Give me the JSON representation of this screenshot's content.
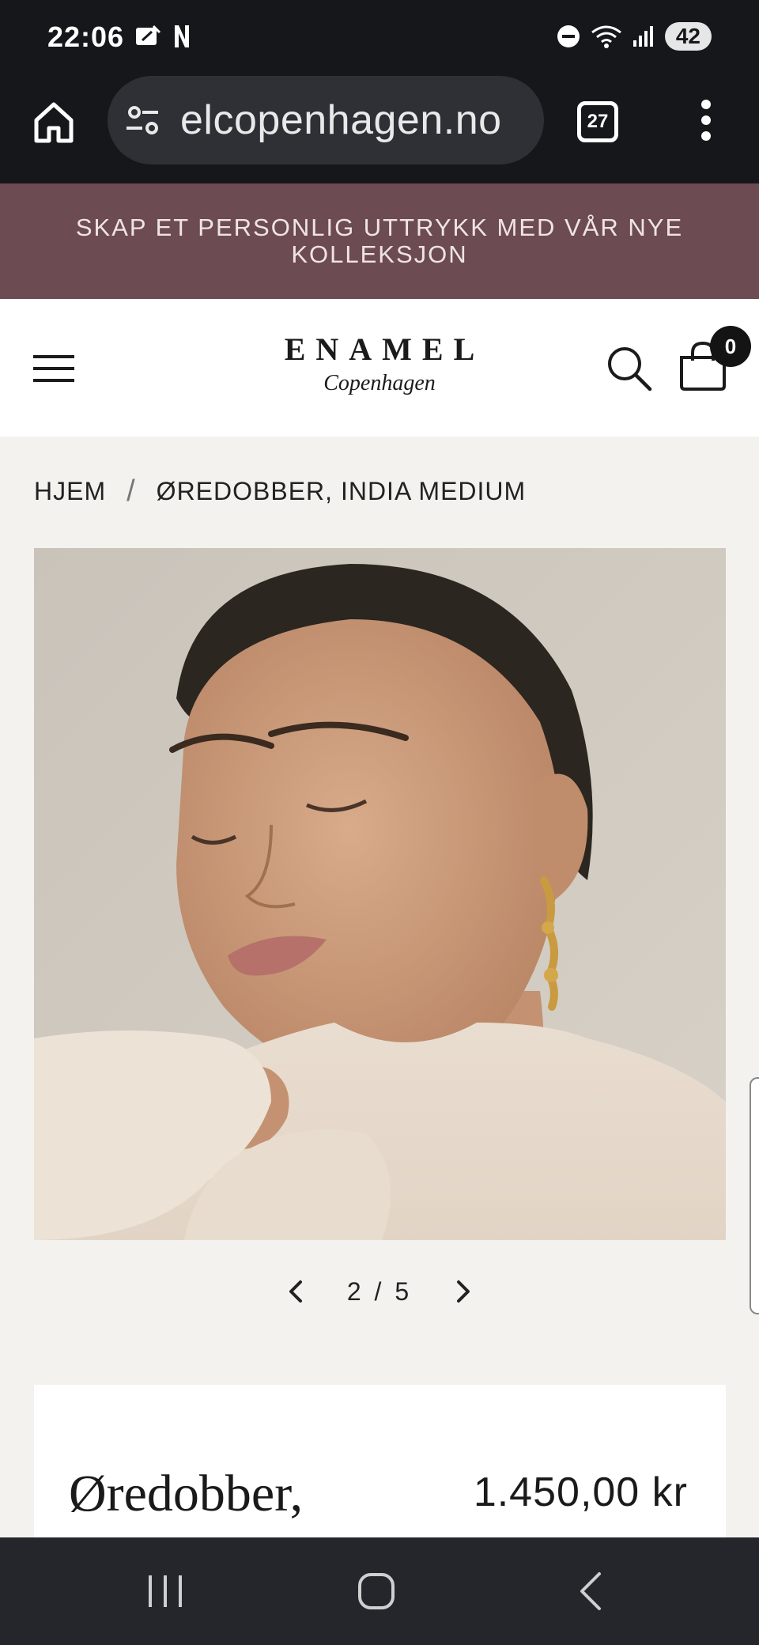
{
  "status_bar": {
    "time": "22:06",
    "battery": "42",
    "icons": [
      "media-icon",
      "n-notification-icon",
      "dnd-icon",
      "wifi-icon",
      "signal-icon"
    ]
  },
  "browser": {
    "url": "elcopenhagen.no",
    "tab_count": "27"
  },
  "announcement": {
    "text": "SKAP ET PERSONLIG UTTRYKK MED VÅR NYE KOLLEKSJON"
  },
  "header": {
    "logo_main": "ENAMEL",
    "logo_sub": "Copenhagen",
    "cart_count": "0"
  },
  "breadcrumb": {
    "home": "HJEM",
    "separator": "/",
    "current": "ØREDOBBER, INDIA MEDIUM"
  },
  "gallery": {
    "pager_text": "2 / 5",
    "current": 2,
    "total": 5
  },
  "product": {
    "title": "Øredobber,",
    "price": "1.450,00 kr"
  },
  "colors": {
    "announcement_bg": "#6d4b52",
    "page_bg": "#f3f2ef",
    "system_bar": "#16171b"
  }
}
